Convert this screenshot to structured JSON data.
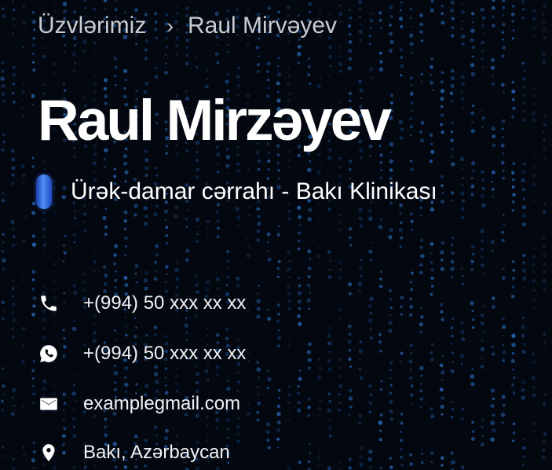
{
  "breadcrumb": {
    "parent": "Üzvlərimiz",
    "separator": "›",
    "current": "Raul Mirvəyev"
  },
  "profile": {
    "name": "Raul Mirzəyev",
    "title": "Ürək-damar cərrahı - Bakı Klinikası"
  },
  "contacts": {
    "phone": {
      "icon": "phone-icon",
      "value": "+(994) 50 xxx xx xx"
    },
    "whatsapp": {
      "icon": "whatsapp-icon",
      "value": "+(994) 50 xxx xx xx"
    },
    "email": {
      "icon": "mail-icon",
      "value": "examplegmail.com"
    },
    "location": {
      "icon": "location-pin-icon",
      "value": "Bakı, Azərbaycan"
    }
  },
  "colors": {
    "background": "#03070f",
    "matrix_dots": "#2f7fe0",
    "accent_pill": "#4f8ef0",
    "text": "#ffffff",
    "breadcrumb_text": "#c9ccd2"
  }
}
